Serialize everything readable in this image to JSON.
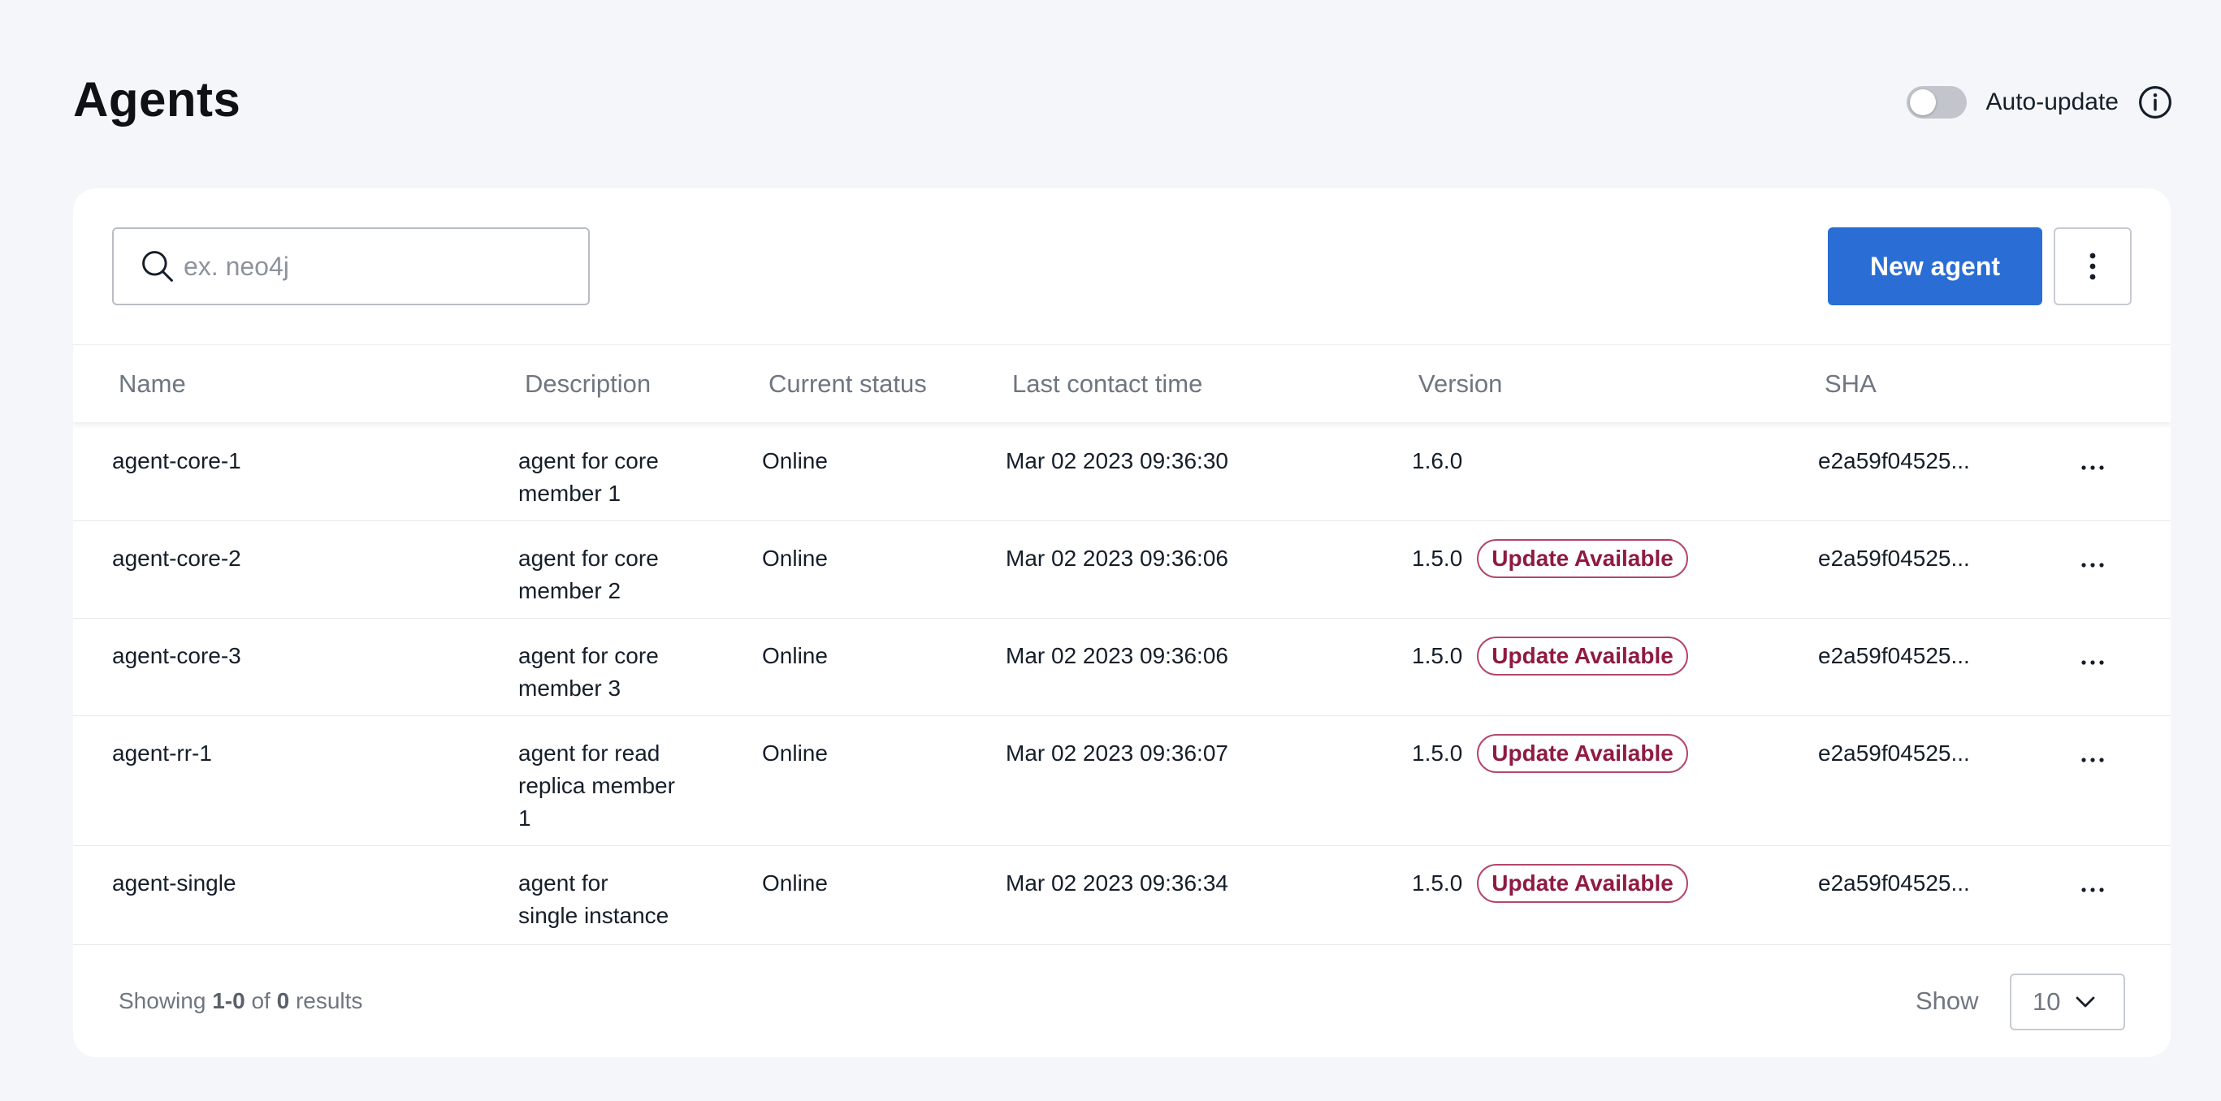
{
  "page": {
    "title": "Agents",
    "auto_update_label": "Auto-update",
    "auto_update_on": false
  },
  "toolbar": {
    "search_placeholder": "ex. neo4j",
    "new_agent_label": "New agent"
  },
  "table": {
    "columns": [
      "Name",
      "Description",
      "Current status",
      "Last contact time",
      "Version",
      "SHA"
    ],
    "rows": [
      {
        "name": "agent-core-1",
        "description": [
          "agent for core",
          "member 1"
        ],
        "status": "Online",
        "last_contact": "Mar 02 2023 09:36:30",
        "version": "1.6.0",
        "badge": "",
        "sha": "e2a59f04525..."
      },
      {
        "name": "agent-core-2",
        "description": [
          "agent for core",
          "member 2"
        ],
        "status": "Online",
        "last_contact": "Mar 02 2023 09:36:06",
        "version": "1.5.0",
        "badge": "Update Available",
        "sha": "e2a59f04525..."
      },
      {
        "name": "agent-core-3",
        "description": [
          "agent for core",
          "member 3"
        ],
        "status": "Online",
        "last_contact": "Mar 02 2023 09:36:06",
        "version": "1.5.0",
        "badge": "Update Available",
        "sha": "e2a59f04525..."
      },
      {
        "name": "agent-rr-1",
        "description": [
          "agent for read",
          "replica member",
          "1"
        ],
        "status": "Online",
        "last_contact": "Mar 02 2023 09:36:07",
        "version": "1.5.0",
        "badge": "Update Available",
        "sha": "e2a59f04525..."
      },
      {
        "name": "agent-single",
        "description": [
          "agent for",
          "single instance"
        ],
        "status": "Online",
        "last_contact": "Mar 02 2023 09:36:34",
        "version": "1.5.0",
        "badge": "Update Available",
        "sha": "e2a59f04525..."
      }
    ]
  },
  "footer": {
    "showing_prefix": "Showing",
    "range": "1-0",
    "of": "of",
    "total": "0",
    "results": "results",
    "show_label": "Show",
    "page_size": "10"
  },
  "icons": {
    "search": "search-icon",
    "info": "info-icon",
    "more": "more-vertical-icon",
    "row_menu": "more-horizontal-icon",
    "chevron": "chevron-down-icon"
  },
  "colors": {
    "primary": "#2a6dd4",
    "badge_text": "#8f1a43",
    "badge_border": "#b3476e",
    "background": "#f5f6fa"
  }
}
